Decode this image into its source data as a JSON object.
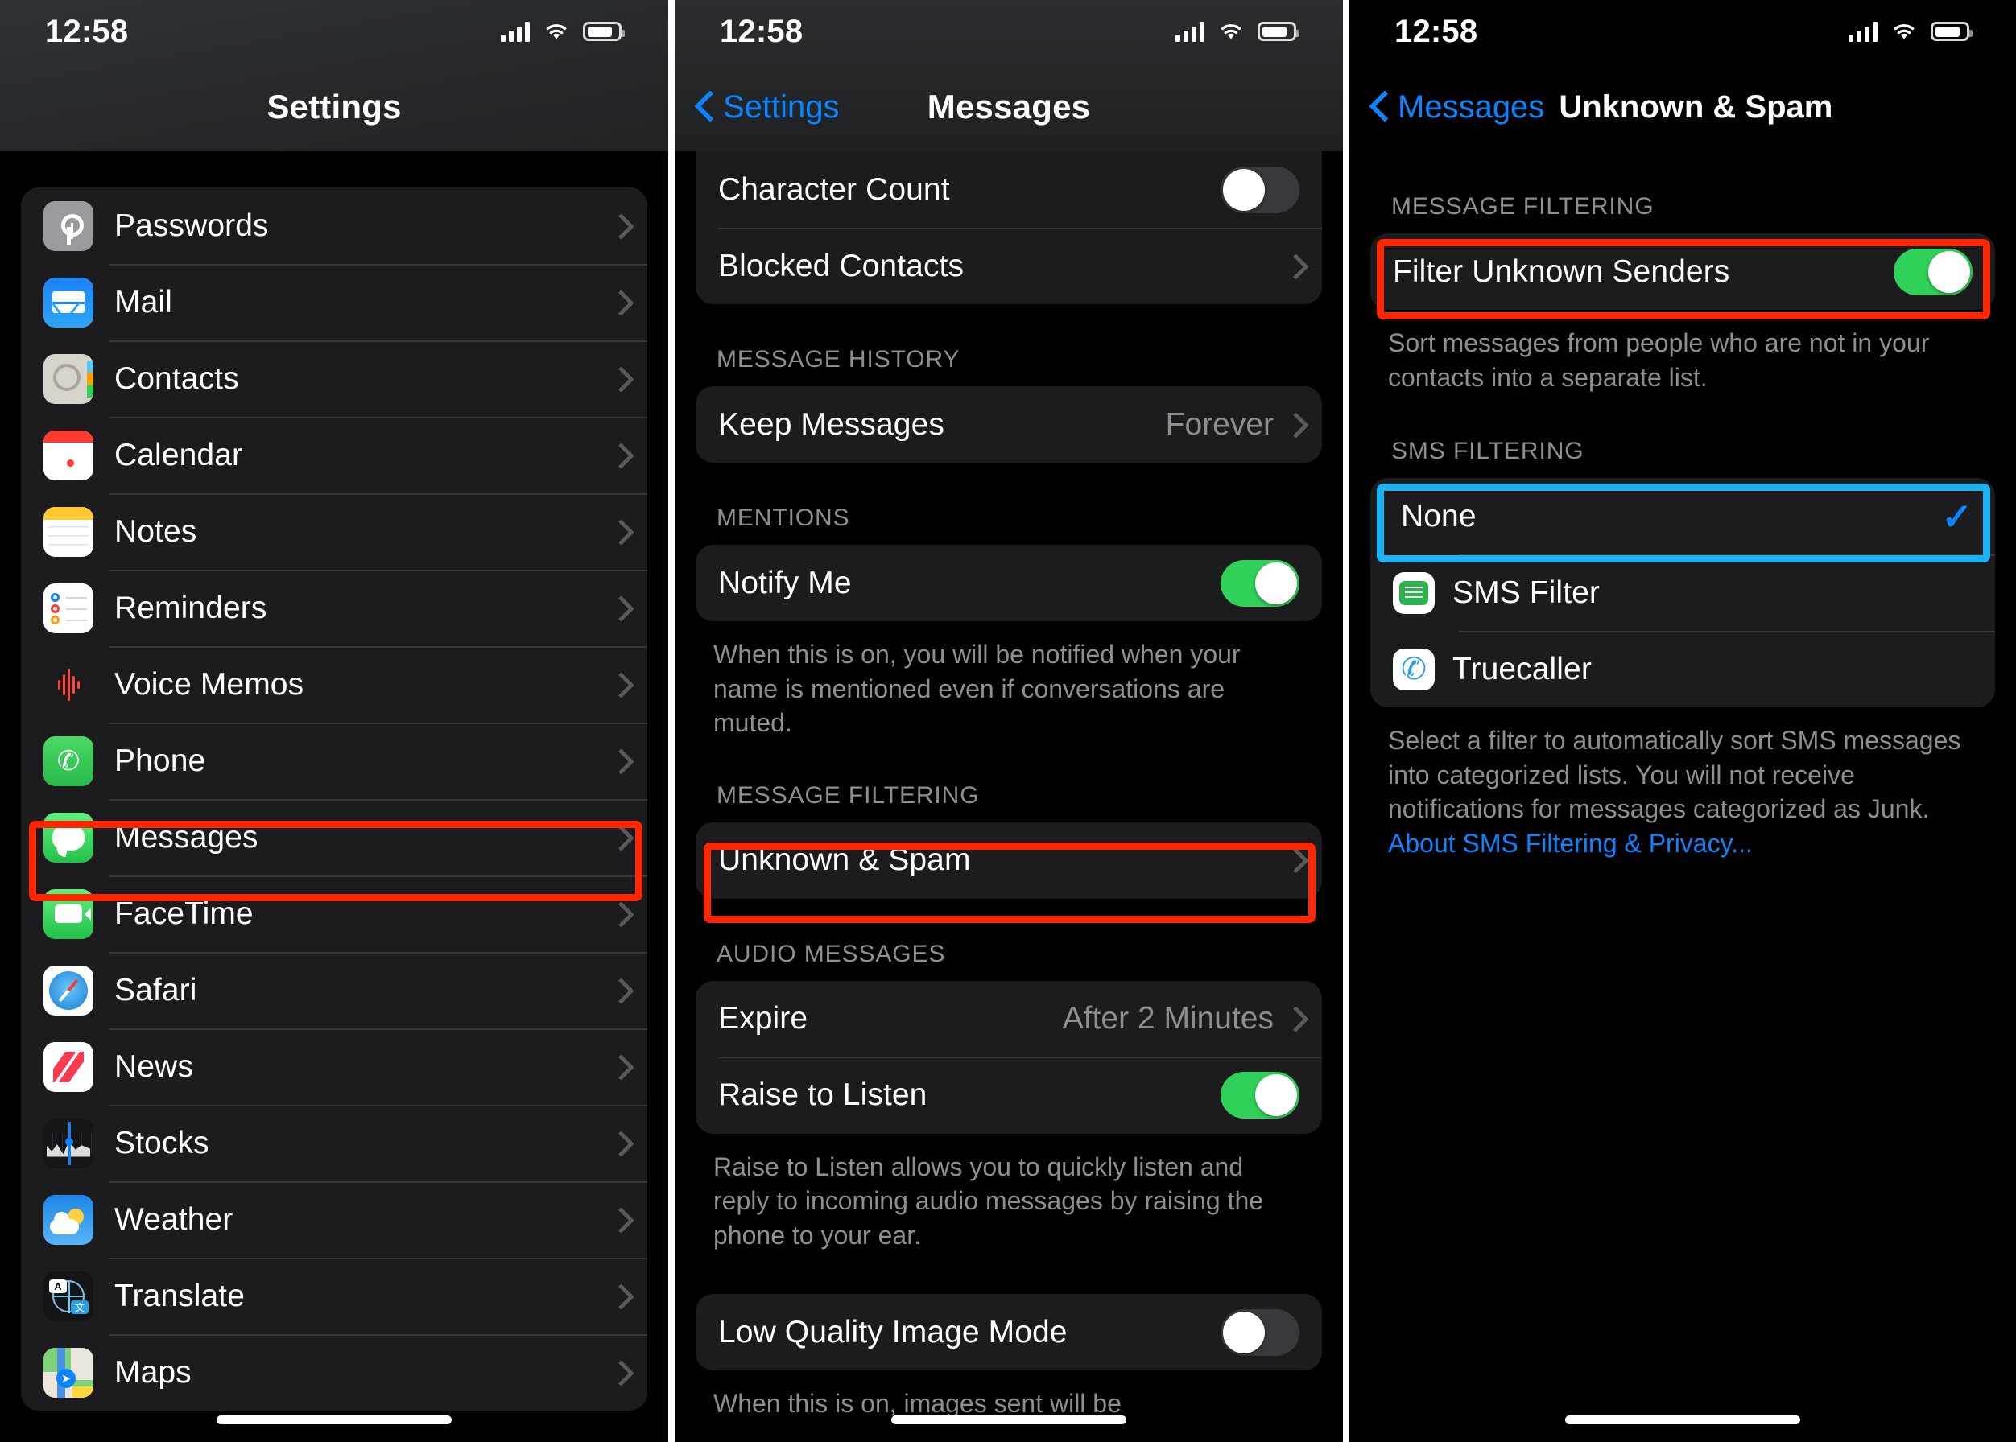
{
  "status_bar": {
    "time": "12:58",
    "wifi_icon": "wifi-icon",
    "battery_icon": "battery-icon",
    "cellular_icon": "cellular-bars-icon"
  },
  "panel1": {
    "title": "Settings",
    "items": [
      {
        "label": "Passwords",
        "icon": "passwords-icon"
      },
      {
        "label": "Mail",
        "icon": "mail-icon"
      },
      {
        "label": "Contacts",
        "icon": "contacts-icon"
      },
      {
        "label": "Calendar",
        "icon": "calendar-icon"
      },
      {
        "label": "Notes",
        "icon": "notes-icon"
      },
      {
        "label": "Reminders",
        "icon": "reminders-icon"
      },
      {
        "label": "Voice Memos",
        "icon": "voice-memos-icon"
      },
      {
        "label": "Phone",
        "icon": "phone-icon"
      },
      {
        "label": "Messages",
        "icon": "messages-icon"
      },
      {
        "label": "FaceTime",
        "icon": "facetime-icon"
      },
      {
        "label": "Safari",
        "icon": "safari-icon"
      },
      {
        "label": "News",
        "icon": "news-icon"
      },
      {
        "label": "Stocks",
        "icon": "stocks-icon"
      },
      {
        "label": "Weather",
        "icon": "weather-icon"
      },
      {
        "label": "Translate",
        "icon": "translate-icon"
      },
      {
        "label": "Maps",
        "icon": "maps-icon"
      }
    ],
    "highlight": {
      "target": "Messages",
      "color": "#ff2600"
    }
  },
  "panel2": {
    "back_label": "Settings",
    "title": "Messages",
    "top_group": [
      {
        "label": "Character Count",
        "control": "toggle",
        "value": "off"
      },
      {
        "label": "Blocked Contacts",
        "control": "chevron"
      }
    ],
    "message_history": {
      "header": "MESSAGE HISTORY",
      "rows": [
        {
          "label": "Keep Messages",
          "value": "Forever",
          "control": "chevron"
        }
      ]
    },
    "mentions": {
      "header": "MENTIONS",
      "rows": [
        {
          "label": "Notify Me",
          "control": "toggle",
          "value": "on"
        }
      ],
      "footer": "When this is on, you will be notified when your name is mentioned even if conversations are muted."
    },
    "message_filtering": {
      "header": "MESSAGE FILTERING",
      "rows": [
        {
          "label": "Unknown & Spam",
          "control": "chevron"
        }
      ]
    },
    "audio_messages": {
      "header": "AUDIO MESSAGES",
      "rows": [
        {
          "label": "Expire",
          "value": "After 2 Minutes",
          "control": "chevron"
        },
        {
          "label": "Raise to Listen",
          "control": "toggle",
          "value": "on"
        }
      ],
      "footer": "Raise to Listen allows you to quickly listen and reply to incoming audio messages by raising the phone to your ear."
    },
    "low_quality": {
      "rows": [
        {
          "label": "Low Quality Image Mode",
          "control": "toggle",
          "value": "off"
        }
      ],
      "footer": "When this is on, images sent will be"
    },
    "highlight": {
      "target": "Unknown & Spam",
      "color": "#ff2600"
    }
  },
  "panel3": {
    "back_label": "Messages",
    "title": "Unknown & Spam",
    "message_filtering": {
      "header": "MESSAGE FILTERING",
      "rows": [
        {
          "label": "Filter Unknown Senders",
          "control": "toggle",
          "value": "on"
        }
      ],
      "footer": "Sort messages from people who are not in your contacts into a separate list."
    },
    "sms_filtering": {
      "header": "SMS FILTERING",
      "rows": [
        {
          "label": "None",
          "selected": true,
          "icon": null
        },
        {
          "label": "SMS Filter",
          "selected": false,
          "icon": "sms-filter-app-icon"
        },
        {
          "label": "Truecaller",
          "selected": false,
          "icon": "truecaller-app-icon"
        }
      ],
      "footer": "Select a filter to automatically sort SMS messages into categorized lists. You will not receive notifications for messages categorized as Junk.",
      "link": "About SMS Filtering & Privacy..."
    },
    "highlights": [
      {
        "target": "Filter Unknown Senders",
        "color": "#ff2600"
      },
      {
        "target": "None",
        "color": "#1ab4f5"
      }
    ]
  }
}
